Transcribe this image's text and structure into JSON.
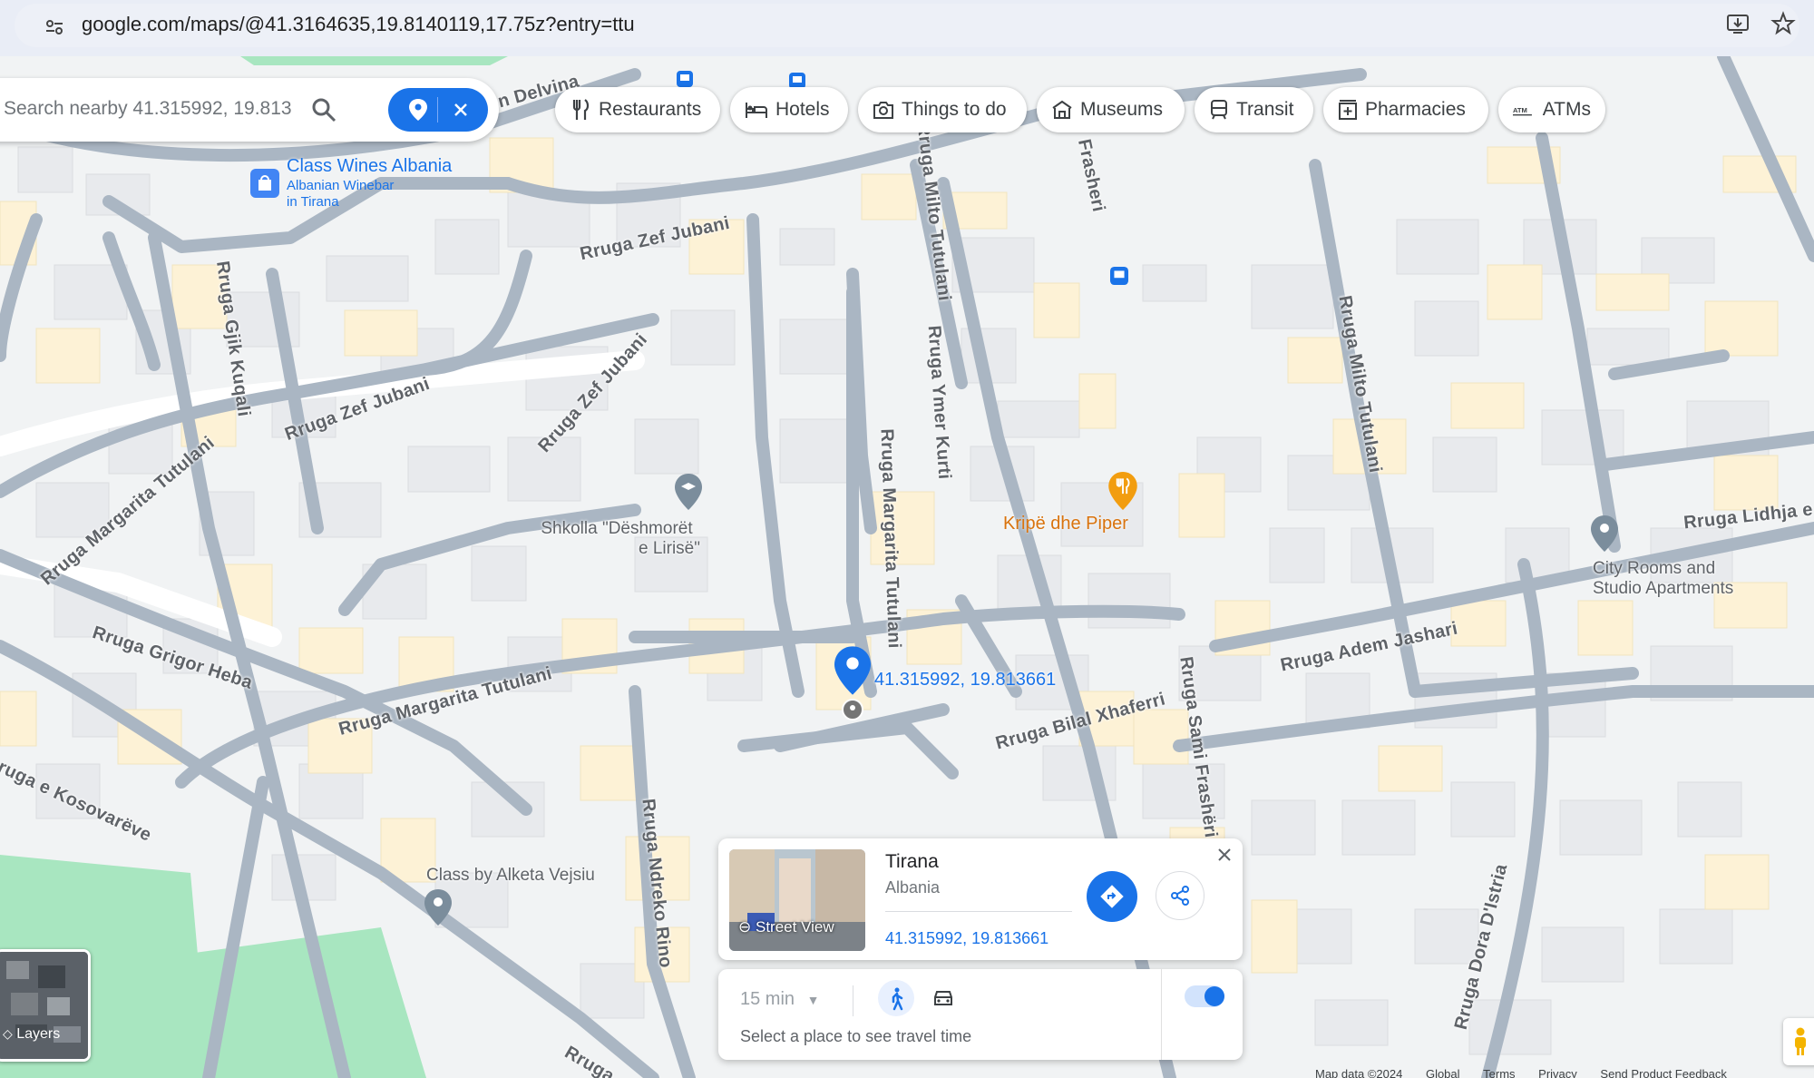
{
  "browser": {
    "url": "google.com/maps/@41.3164635,19.8140119,17.75z?entry=ttu"
  },
  "search": {
    "value": "Search nearby 41.315992, 19.813"
  },
  "chips": [
    {
      "label": "Restaurants",
      "icon": "fork-knife-icon"
    },
    {
      "label": "Hotels",
      "icon": "bed-icon"
    },
    {
      "label": "Things to do",
      "icon": "camera-icon"
    },
    {
      "label": "Museums",
      "icon": "museum-icon"
    },
    {
      "label": "Transit",
      "icon": "train-icon"
    },
    {
      "label": "Pharmacies",
      "icon": "pharmacy-icon"
    },
    {
      "label": "ATMs",
      "icon": "atm-icon"
    }
  ],
  "streets": {
    "delvina": "n Delvina",
    "zef_jubani_1": "Rruga Zef Jubani",
    "zef_jubani_2": "Rruga Zef Jubani",
    "zef_jubani_3": "Rruga Zef Jubani",
    "gjik_kugali": "Rruga Gjik Kuqali",
    "ymer_kurti": "Rruga Ymer Kurti",
    "frasheri_top": "Frasheri",
    "milto_tutulani": "Rruga Milto Tutulani",
    "margarita_1": "Rruga Margarita Tutulani",
    "margarita_2": "Rruga Margarita Tutulani",
    "margarita_3": "Rruga Margarita Tutulani",
    "grigor_heba": "Rruga Grigor Heba",
    "kosovareve": "ruga e Kosovarëve",
    "ndreko_rino": "Rruga Ndreko Rino",
    "bilal_xhaferri": "Rruga Bilal Xhaferri",
    "sami_frasheri": "Rruga Sami Frashëri",
    "adem_jashari": "Rruga Adem Jashari",
    "lidhja": "Rruga Lidhja e",
    "dora_distria": "Rruga Dora D'Istria",
    "rruga_bottom": "Rruga"
  },
  "pois": {
    "class_wines": {
      "name": "Class Wines Albania",
      "sub1": "Albanian Winebar",
      "sub2": "in Tirana"
    },
    "shkolla": {
      "line1": "Shkolla \"Dëshmorët",
      "line2": "e Lirisë\""
    },
    "kripe": {
      "name": "Kripë dhe Piper"
    },
    "city_rooms": {
      "line1": "City Rooms and",
      "line2": "Studio Apartments"
    },
    "class_alketa": {
      "name": "Class by Alketa Vejsiu"
    },
    "pin_label": "41.315992, 19.813661"
  },
  "place_card": {
    "title": "Tirana",
    "subtitle": "Albania",
    "coords": "41.315992, 19.813661",
    "street_view": "Street View"
  },
  "travel": {
    "duration": "15 min",
    "hint": "Select a place to see travel time"
  },
  "layers": {
    "label": "Layers"
  },
  "footer": [
    "Map data ©2024",
    "Global",
    "Terms",
    "Privacy",
    "Send Product Feedback"
  ],
  "colors": {
    "map_bg": "#f1f3f4",
    "road": "#aab6c3",
    "building": "#e8eaed",
    "building_warm": "#fdf2d6",
    "park": "#a8e6c0",
    "accent_blue": "#1a73e8",
    "poi_orange": "#e8830c",
    "link_blue": "#1a73e8"
  }
}
